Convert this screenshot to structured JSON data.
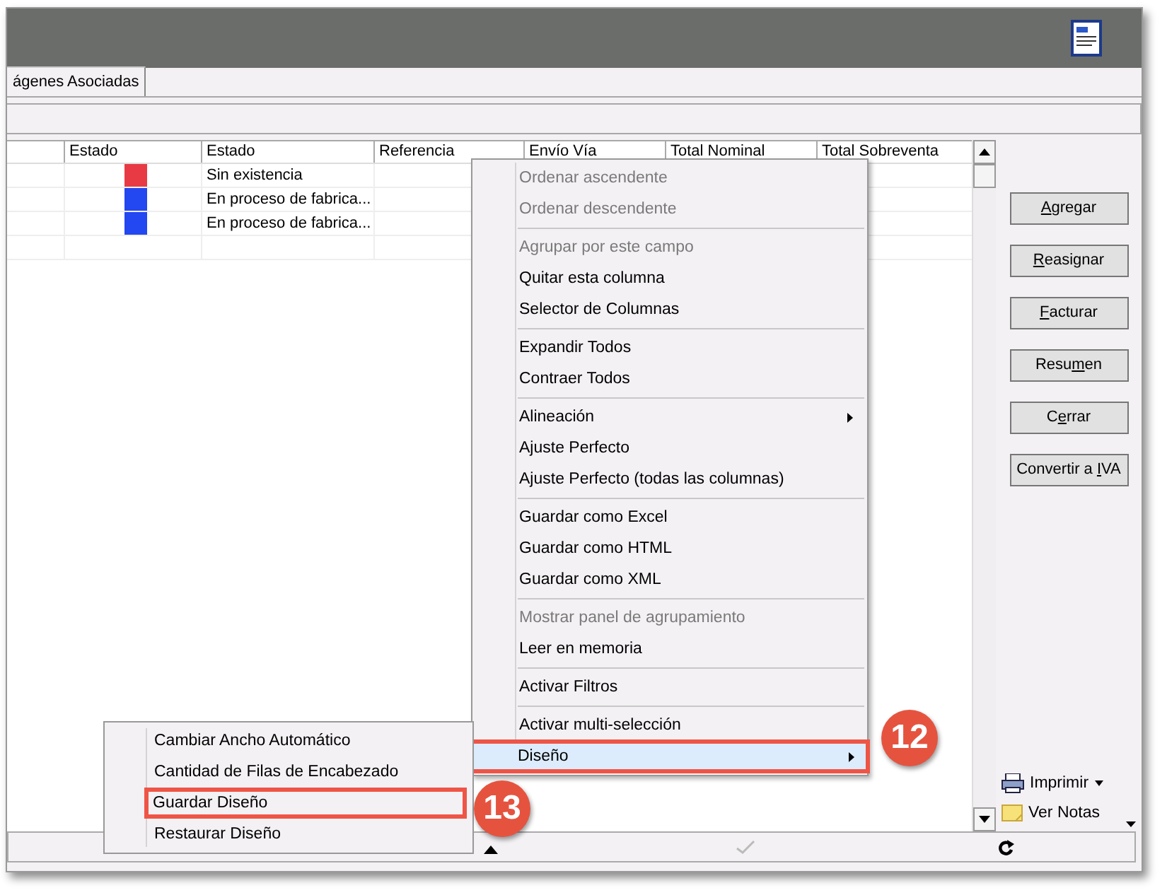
{
  "tab": {
    "label": "ágenes Asociadas",
    "selected": true
  },
  "grid": {
    "columns": [
      "Estado",
      "Estado",
      "Referencia",
      "Envío Vía",
      "Total Nominal",
      "Total Sobreventa"
    ],
    "rows": [
      {
        "color": "#e83a44",
        "estado": "Sin existencia"
      },
      {
        "color": "#2347f0",
        "estado": "En proceso de fabrica..."
      },
      {
        "color": "#2347f0",
        "estado": "En proceso de fabrica..."
      }
    ]
  },
  "buttons": [
    {
      "key": "A",
      "after": "gregar"
    },
    {
      "key": "R",
      "after": "easignar"
    },
    {
      "key": "F",
      "after": "acturar"
    },
    {
      "before": "Resu",
      "key": "m",
      "after": "en"
    },
    {
      "before": "C",
      "key": "e",
      "after": "rrar"
    },
    {
      "before": "Convertir a ",
      "key": "I",
      "after": "VA"
    }
  ],
  "tools": [
    {
      "kind": "print",
      "label": "Imprimir"
    },
    {
      "kind": "notes",
      "label": "Ver Notas"
    }
  ],
  "context_menu": [
    {
      "kind": "item",
      "label": "Ordenar ascendente",
      "disabled": true
    },
    {
      "kind": "item",
      "label": "Ordenar descendente",
      "disabled": true
    },
    {
      "kind": "separator"
    },
    {
      "kind": "item",
      "label": "Agrupar por este campo",
      "disabled": true
    },
    {
      "kind": "item",
      "label": "Quitar esta columna",
      "disabled": false
    },
    {
      "kind": "item",
      "label": "Selector de Columnas",
      "disabled": false
    },
    {
      "kind": "separator"
    },
    {
      "kind": "item",
      "label": "Expandir Todos",
      "disabled": false
    },
    {
      "kind": "item",
      "label": "Contraer Todos",
      "disabled": false
    },
    {
      "kind": "separator"
    },
    {
      "kind": "item",
      "label": "Alineación",
      "disabled": false,
      "submenu": true
    },
    {
      "kind": "item",
      "label": "Ajuste Perfecto",
      "disabled": false
    },
    {
      "kind": "item",
      "label": "Ajuste Perfecto (todas las columnas)",
      "disabled": false
    },
    {
      "kind": "separator"
    },
    {
      "kind": "item",
      "label": "Guardar como Excel",
      "disabled": false
    },
    {
      "kind": "item",
      "label": "Guardar como HTML",
      "disabled": false
    },
    {
      "kind": "item",
      "label": "Guardar como XML",
      "disabled": false
    },
    {
      "kind": "separator"
    },
    {
      "kind": "item",
      "label": "Mostrar panel de agrupamiento",
      "disabled": true
    },
    {
      "kind": "item",
      "label": "Leer en memoria",
      "disabled": false
    },
    {
      "kind": "separator"
    },
    {
      "kind": "item",
      "label": "Activar Filtros",
      "disabled": false
    },
    {
      "kind": "separator"
    },
    {
      "kind": "item",
      "label": "Activar multi-selección",
      "disabled": false
    },
    {
      "kind": "item",
      "label": "Diseño",
      "disabled": false,
      "submenu": true,
      "selected": true,
      "callout": "12"
    }
  ],
  "submenu": [
    {
      "label": "Cambiar Ancho Automático",
      "callout_box": false
    },
    {
      "label": "Cantidad de Filas de Encabezado",
      "callout_box": false
    },
    {
      "label": "Guardar Diseño",
      "callout_box": true,
      "callout": "13"
    },
    {
      "label": "Restaurar Diseño",
      "callout_box": false
    }
  ]
}
